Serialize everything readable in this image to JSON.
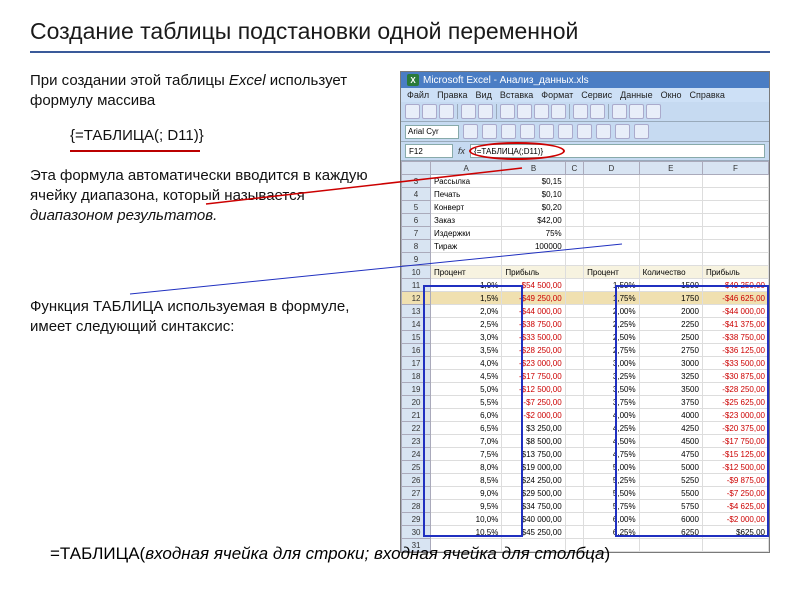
{
  "title": "Создание таблицы подстановки одной переменной",
  "para1_a": "При создании этой таблицы ",
  "para1_em": "Excel",
  "para1_b": " использует формулу массива",
  "formula": "{=ТАБЛИЦА(; D11)}",
  "para2_a": "Эта формула автоматически вводится в каждую ячейку диапазона, который называется ",
  "para2_em": "диапазоном результатов.",
  "para3": "Функция ТАБЛИЦА используемая в формуле, имеет следующий синтаксис:",
  "syntax_a": "=ТАБЛИЦА(",
  "syntax_em": "входная ячейка для строки; входная ячейка для столбца",
  "syntax_b": ")",
  "excel_title": "Microsoft Excel - Анализ_данных.xls",
  "menus": [
    "Файл",
    "Правка",
    "Вид",
    "Вставка",
    "Формат",
    "Сервис",
    "Данные",
    "Окно",
    "Справка"
  ],
  "font": "Arial Cyr",
  "name_box": "F12",
  "formula_bar": "{=ТАБЛИЦА(;D11)}",
  "col_headers": [
    "A",
    "B",
    "C",
    "D",
    "E",
    "F"
  ],
  "params": [
    {
      "r": "3",
      "lbl": "Рассылка",
      "val": "$0,15"
    },
    {
      "r": "4",
      "lbl": "Печать",
      "val": "$0,10"
    },
    {
      "r": "5",
      "lbl": "Конверт",
      "val": "$0,20"
    },
    {
      "r": "6",
      "lbl": "Заказ",
      "val": "$42,00"
    },
    {
      "r": "7",
      "lbl": "Издержки",
      "val": "75%"
    },
    {
      "r": "8",
      "lbl": "Тираж",
      "val": "100000"
    }
  ],
  "hdr_left": [
    "Процент",
    "Прибыль"
  ],
  "hdr_right": [
    "Процент",
    "Количество",
    "Прибыль"
  ],
  "rows": [
    {
      "r": "11",
      "pL": "1,0%",
      "vL": "-$54 500,00",
      "n1": true,
      "pR": "1,50%",
      "qR": "1500",
      "vR": "-$49 250,00",
      "n2": true
    },
    {
      "r": "12",
      "pL": "1,5%",
      "vL": "-$49 250,00",
      "n1": true,
      "pR": "1,75%",
      "qR": "1750",
      "vR": "-$46 625,00",
      "n2": true,
      "active": true
    },
    {
      "r": "13",
      "pL": "2,0%",
      "vL": "-$44 000,00",
      "n1": true,
      "pR": "2,00%",
      "qR": "2000",
      "vR": "-$44 000,00",
      "n2": true
    },
    {
      "r": "14",
      "pL": "2,5%",
      "vL": "-$38 750,00",
      "n1": true,
      "pR": "2,25%",
      "qR": "2250",
      "vR": "-$41 375,00",
      "n2": true
    },
    {
      "r": "15",
      "pL": "3,0%",
      "vL": "-$33 500,00",
      "n1": true,
      "pR": "2,50%",
      "qR": "2500",
      "vR": "-$38 750,00",
      "n2": true
    },
    {
      "r": "16",
      "pL": "3,5%",
      "vL": "-$28 250,00",
      "n1": true,
      "pR": "2,75%",
      "qR": "2750",
      "vR": "-$36 125,00",
      "n2": true
    },
    {
      "r": "17",
      "pL": "4,0%",
      "vL": "-$23 000,00",
      "n1": true,
      "pR": "3,00%",
      "qR": "3000",
      "vR": "-$33 500,00",
      "n2": true
    },
    {
      "r": "18",
      "pL": "4,5%",
      "vL": "-$17 750,00",
      "n1": true,
      "pR": "3,25%",
      "qR": "3250",
      "vR": "-$30 875,00",
      "n2": true
    },
    {
      "r": "19",
      "pL": "5,0%",
      "vL": "-$12 500,00",
      "n1": true,
      "pR": "3,50%",
      "qR": "3500",
      "vR": "-$28 250,00",
      "n2": true
    },
    {
      "r": "20",
      "pL": "5,5%",
      "vL": "-$7 250,00",
      "n1": true,
      "pR": "3,75%",
      "qR": "3750",
      "vR": "-$25 625,00",
      "n2": true
    },
    {
      "r": "21",
      "pL": "6,0%",
      "vL": "-$2 000,00",
      "n1": true,
      "pR": "4,00%",
      "qR": "4000",
      "vR": "-$23 000,00",
      "n2": true
    },
    {
      "r": "22",
      "pL": "6,5%",
      "vL": "$3 250,00",
      "n1": false,
      "pR": "4,25%",
      "qR": "4250",
      "vR": "-$20 375,00",
      "n2": true
    },
    {
      "r": "23",
      "pL": "7,0%",
      "vL": "$8 500,00",
      "n1": false,
      "pR": "4,50%",
      "qR": "4500",
      "vR": "-$17 750,00",
      "n2": true
    },
    {
      "r": "24",
      "pL": "7,5%",
      "vL": "$13 750,00",
      "n1": false,
      "pR": "4,75%",
      "qR": "4750",
      "vR": "-$15 125,00",
      "n2": true
    },
    {
      "r": "25",
      "pL": "8,0%",
      "vL": "$19 000,00",
      "n1": false,
      "pR": "5,00%",
      "qR": "5000",
      "vR": "-$12 500,00",
      "n2": true
    },
    {
      "r": "26",
      "pL": "8,5%",
      "vL": "$24 250,00",
      "n1": false,
      "pR": "5,25%",
      "qR": "5250",
      "vR": "-$9 875,00",
      "n2": true
    },
    {
      "r": "27",
      "pL": "9,0%",
      "vL": "$29 500,00",
      "n1": false,
      "pR": "5,50%",
      "qR": "5500",
      "vR": "-$7 250,00",
      "n2": true
    },
    {
      "r": "28",
      "pL": "9,5%",
      "vL": "$34 750,00",
      "n1": false,
      "pR": "5,75%",
      "qR": "5750",
      "vR": "-$4 625,00",
      "n2": true
    },
    {
      "r": "29",
      "pL": "10,0%",
      "vL": "$40 000,00",
      "n1": false,
      "pR": "6,00%",
      "qR": "6000",
      "vR": "-$2 000,00",
      "n2": true
    },
    {
      "r": "30",
      "pL": "10,5%",
      "vL": "$45 250,00",
      "n1": false,
      "pR": "6,25%",
      "qR": "6250",
      "vR": "$625,00",
      "n2": false
    }
  ]
}
